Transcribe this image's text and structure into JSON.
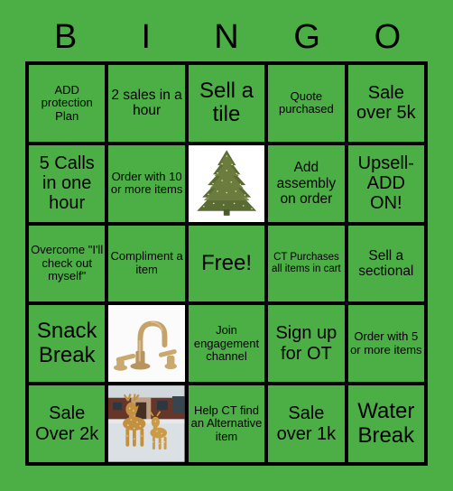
{
  "card": {
    "title": "BINGO",
    "background_color": "#4CAF45",
    "cell_color": "#4CAF45",
    "border_color": "#000000",
    "text_color": "#000000"
  },
  "header": {
    "letters": [
      "B",
      "I",
      "N",
      "G",
      "O"
    ]
  },
  "grid": {
    "rows": 5,
    "columns": 5,
    "cells": [
      {
        "id": "b1",
        "text": "ADD protection Plan",
        "size": "sm",
        "type": "text"
      },
      {
        "id": "i1",
        "text": "2 sales in a hour",
        "size": "md",
        "type": "text"
      },
      {
        "id": "n1",
        "text": "Sell a tile",
        "size": "xl",
        "type": "text"
      },
      {
        "id": "g1",
        "text": "Quote purchased",
        "size": "sm",
        "type": "text"
      },
      {
        "id": "o1",
        "text": "Sale over 5k",
        "size": "lg",
        "type": "text"
      },
      {
        "id": "b2",
        "text": "5 Calls in one hour",
        "size": "lg",
        "type": "text"
      },
      {
        "id": "i2",
        "text": "Order with 10 or more items",
        "size": "sm",
        "type": "text"
      },
      {
        "id": "n2",
        "text": "",
        "size": "sm",
        "type": "image",
        "image": "christmas-tree"
      },
      {
        "id": "g2",
        "text": "Add assembly on order",
        "size": "md",
        "type": "text"
      },
      {
        "id": "o2",
        "text": "Upsell- ADD ON!",
        "size": "lg",
        "type": "text"
      },
      {
        "id": "b3",
        "text": "Overcome \"I'll check out myself\"",
        "size": "sm",
        "type": "text"
      },
      {
        "id": "i3",
        "text": "Compliment a item",
        "size": "sm",
        "type": "text"
      },
      {
        "id": "n3",
        "text": "Free!",
        "size": "xl",
        "type": "text"
      },
      {
        "id": "g3",
        "text": "CT Purchases all items in cart",
        "size": "xs",
        "type": "text"
      },
      {
        "id": "o3",
        "text": "Sell a sectional",
        "size": "md",
        "type": "text"
      },
      {
        "id": "b4",
        "text": "Snack Break",
        "size": "xl",
        "type": "text"
      },
      {
        "id": "i4",
        "text": "",
        "size": "sm",
        "type": "image",
        "image": "gold-faucet"
      },
      {
        "id": "n4",
        "text": "Join engagement channel",
        "size": "sm",
        "type": "text"
      },
      {
        "id": "g4",
        "text": "Sign up for OT",
        "size": "lg",
        "type": "text"
      },
      {
        "id": "o4",
        "text": "Order with 5 or more items",
        "size": "sm",
        "type": "text"
      },
      {
        "id": "b5",
        "text": "Sale Over 2k",
        "size": "lg",
        "type": "text"
      },
      {
        "id": "i5",
        "text": "",
        "size": "sm",
        "type": "image",
        "image": "lighted-reindeer"
      },
      {
        "id": "n5",
        "text": "Help CT find an Alternative item",
        "size": "sm",
        "type": "text"
      },
      {
        "id": "g5",
        "text": "Sale over 1k",
        "size": "lg",
        "type": "text"
      },
      {
        "id": "o5",
        "text": "Water Break",
        "size": "xl",
        "type": "text"
      }
    ]
  }
}
